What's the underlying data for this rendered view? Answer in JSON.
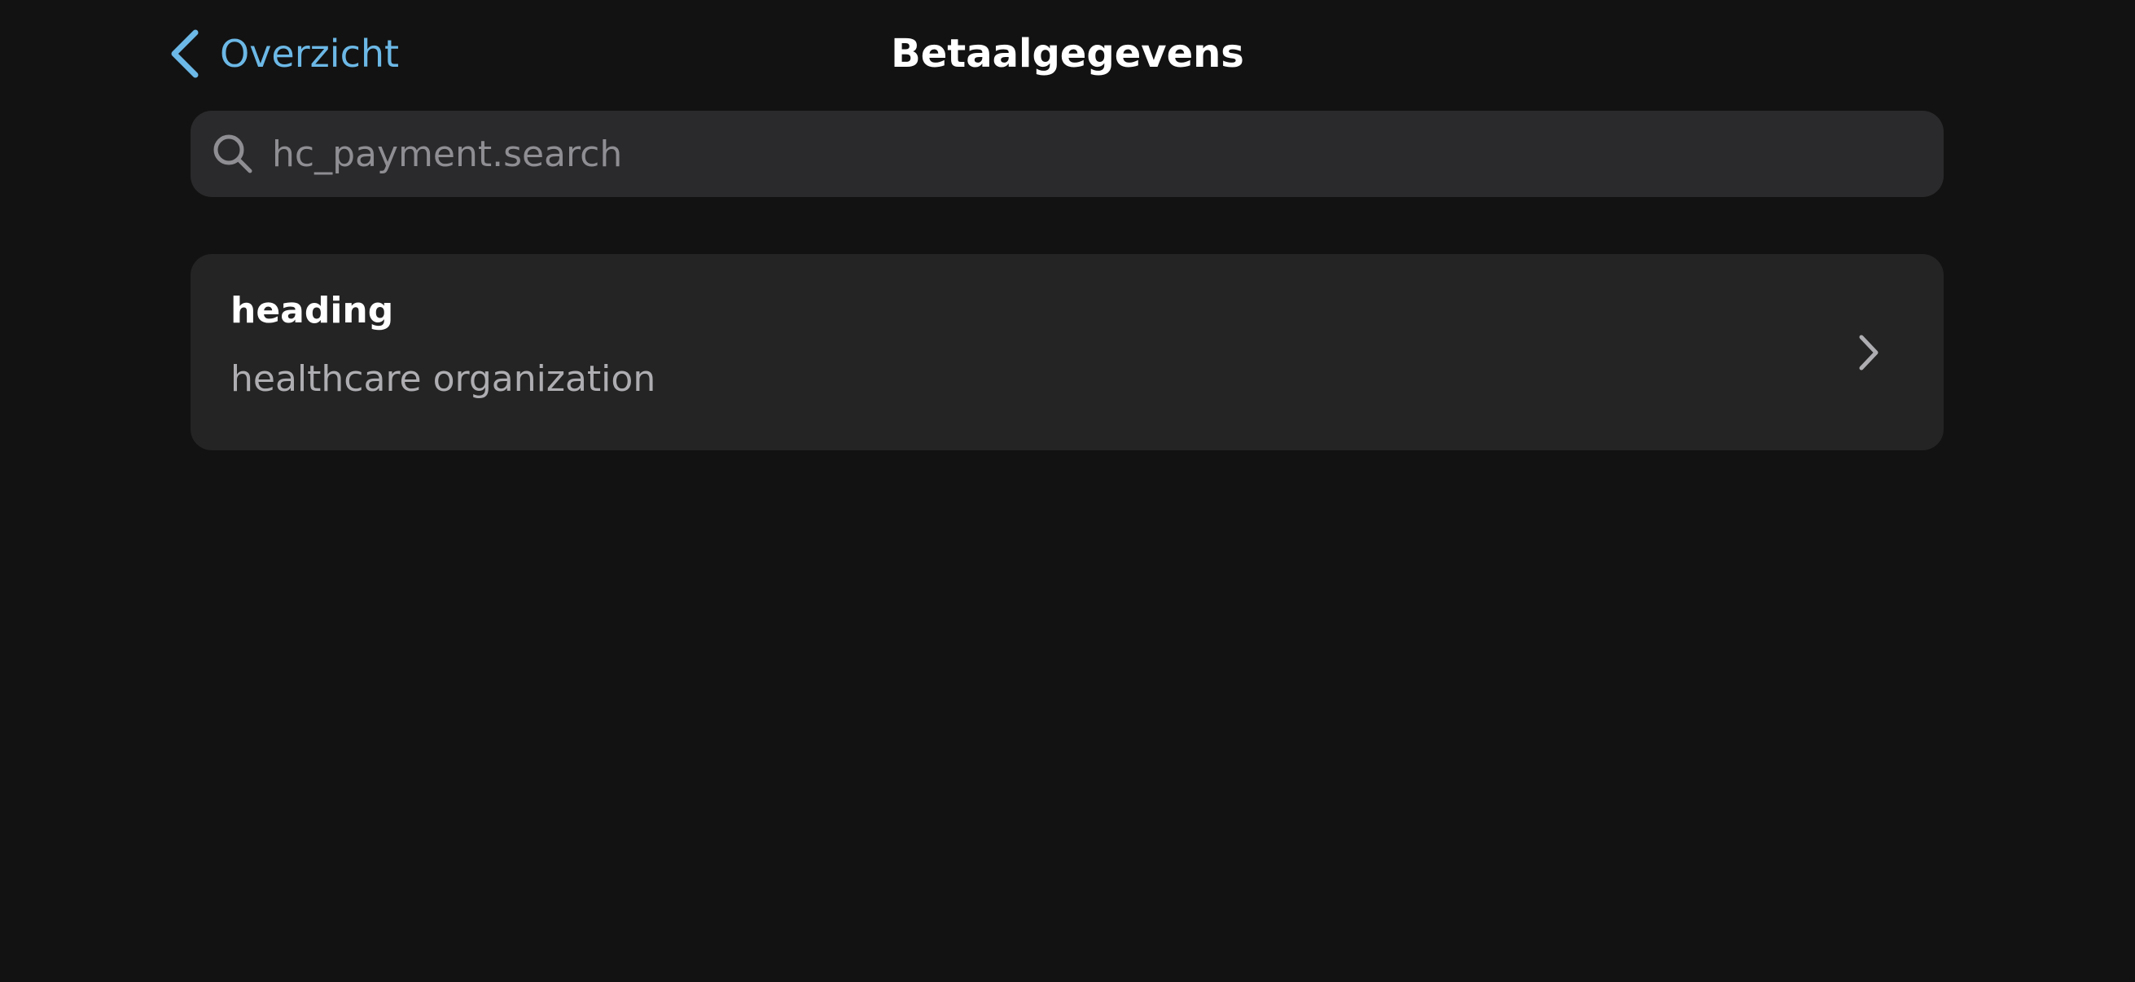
{
  "nav": {
    "back_label": "Overzicht",
    "title": "Betaalgegevens"
  },
  "search": {
    "placeholder": "hc_payment.search",
    "value": ""
  },
  "list": {
    "items": [
      {
        "heading": "heading",
        "subtitle": "healthcare organization"
      }
    ]
  },
  "colors": {
    "background": "#121212",
    "accent": "#6cb8e6",
    "search_bg": "#2a2a2c",
    "card_bg": "#242424"
  },
  "icons": {
    "back": "chevron-left-icon",
    "search": "search-icon",
    "row_disclosure": "chevron-right-icon"
  }
}
